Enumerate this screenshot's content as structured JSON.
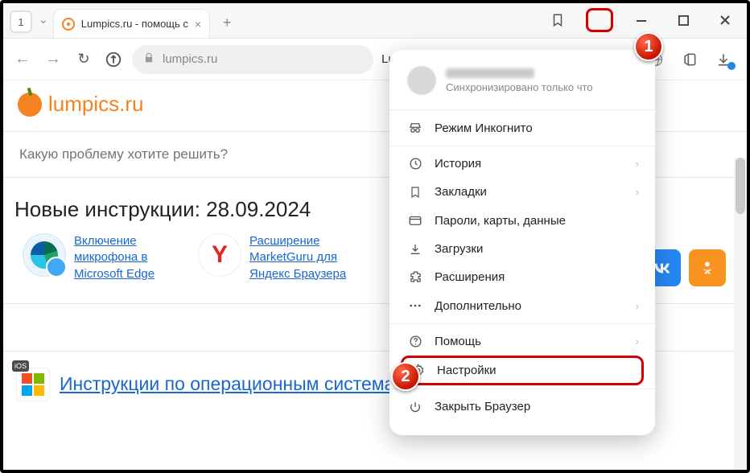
{
  "tabstrip": {
    "count": "1",
    "active_tab_title": "Lumpics.ru - помощь с"
  },
  "addr": {
    "url_host": "lumpics.ru",
    "page_desc": "Lumpics.ru - помощь с"
  },
  "site": {
    "logo_text": "lumpics.ru",
    "search_placeholder": "Какую проблему хотите решить?"
  },
  "section": {
    "new_instructions": "Новые инструкции: 28.09.2024"
  },
  "cards": [
    {
      "title": "Включение микрофона в Microsoft Edge"
    },
    {
      "title": "Расширение MarketGuru для Яндекс Браузера"
    }
  ],
  "os_heading": "Инструкции по операционным системам",
  "menu": {
    "sync_sub": "Синхронизировано только что",
    "incognito": "Режим Инкогнито",
    "history": "История",
    "bookmarks": "Закладки",
    "passwords": "Пароли, карты, данные",
    "downloads": "Загрузки",
    "extensions": "Расширения",
    "more": "Дополнительно",
    "help": "Помощь",
    "settings": "Настройки",
    "close": "Закрыть Браузер"
  },
  "callouts": {
    "b1": "1",
    "b2": "2"
  },
  "social": {
    "vk": "VK",
    "ok": "OK"
  }
}
